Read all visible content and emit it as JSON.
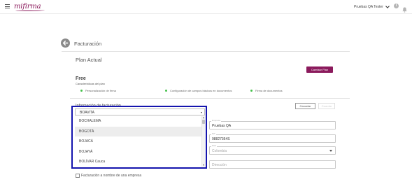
{
  "header": {
    "logo_text": "mifirma",
    "user_name": "Pruebas QA Tester",
    "info_glyph": "i",
    "icons": [
      "hamburger-icon",
      "chevron-down-icon",
      "info-icon",
      "bell-icon"
    ]
  },
  "page": {
    "title": "Facturación",
    "back_icon": "arrow-left-icon"
  },
  "plan": {
    "section_title": "Plan Actual",
    "change_plan_label": "Cambiar Plan",
    "name": "Free",
    "features_label": "Características del plan",
    "features": [
      "Personalización de firma",
      "Configuración de campos básicos en documentos",
      "Firma de documentos"
    ]
  },
  "billing": {
    "section_title": "Información de facturación",
    "cancel_label": "Cancelar",
    "save_label": "Guardar",
    "city_dropdown": {
      "selected": "BOAVITA",
      "options": [
        "BOCHALEMA",
        "BOGOTÁ",
        "BOJACÁ",
        "BOJAYÁ",
        "BOLÍVAR Cauca"
      ],
      "hovered_index": 1
    },
    "fields": {
      "company_label": "Empresa",
      "company_value": "Pruebas QA",
      "nit_label": "NIT",
      "nit_value": "98827364S",
      "country_label": "País",
      "country_value": "Colombia",
      "address_placeholder": "Dirección"
    },
    "company_checkbox_label": "Facturación a nombre de una empresa"
  },
  "colors": {
    "brand": "#8b1a5c",
    "highlight_border": "#1515ae",
    "feature_dot": "#44c14a"
  }
}
